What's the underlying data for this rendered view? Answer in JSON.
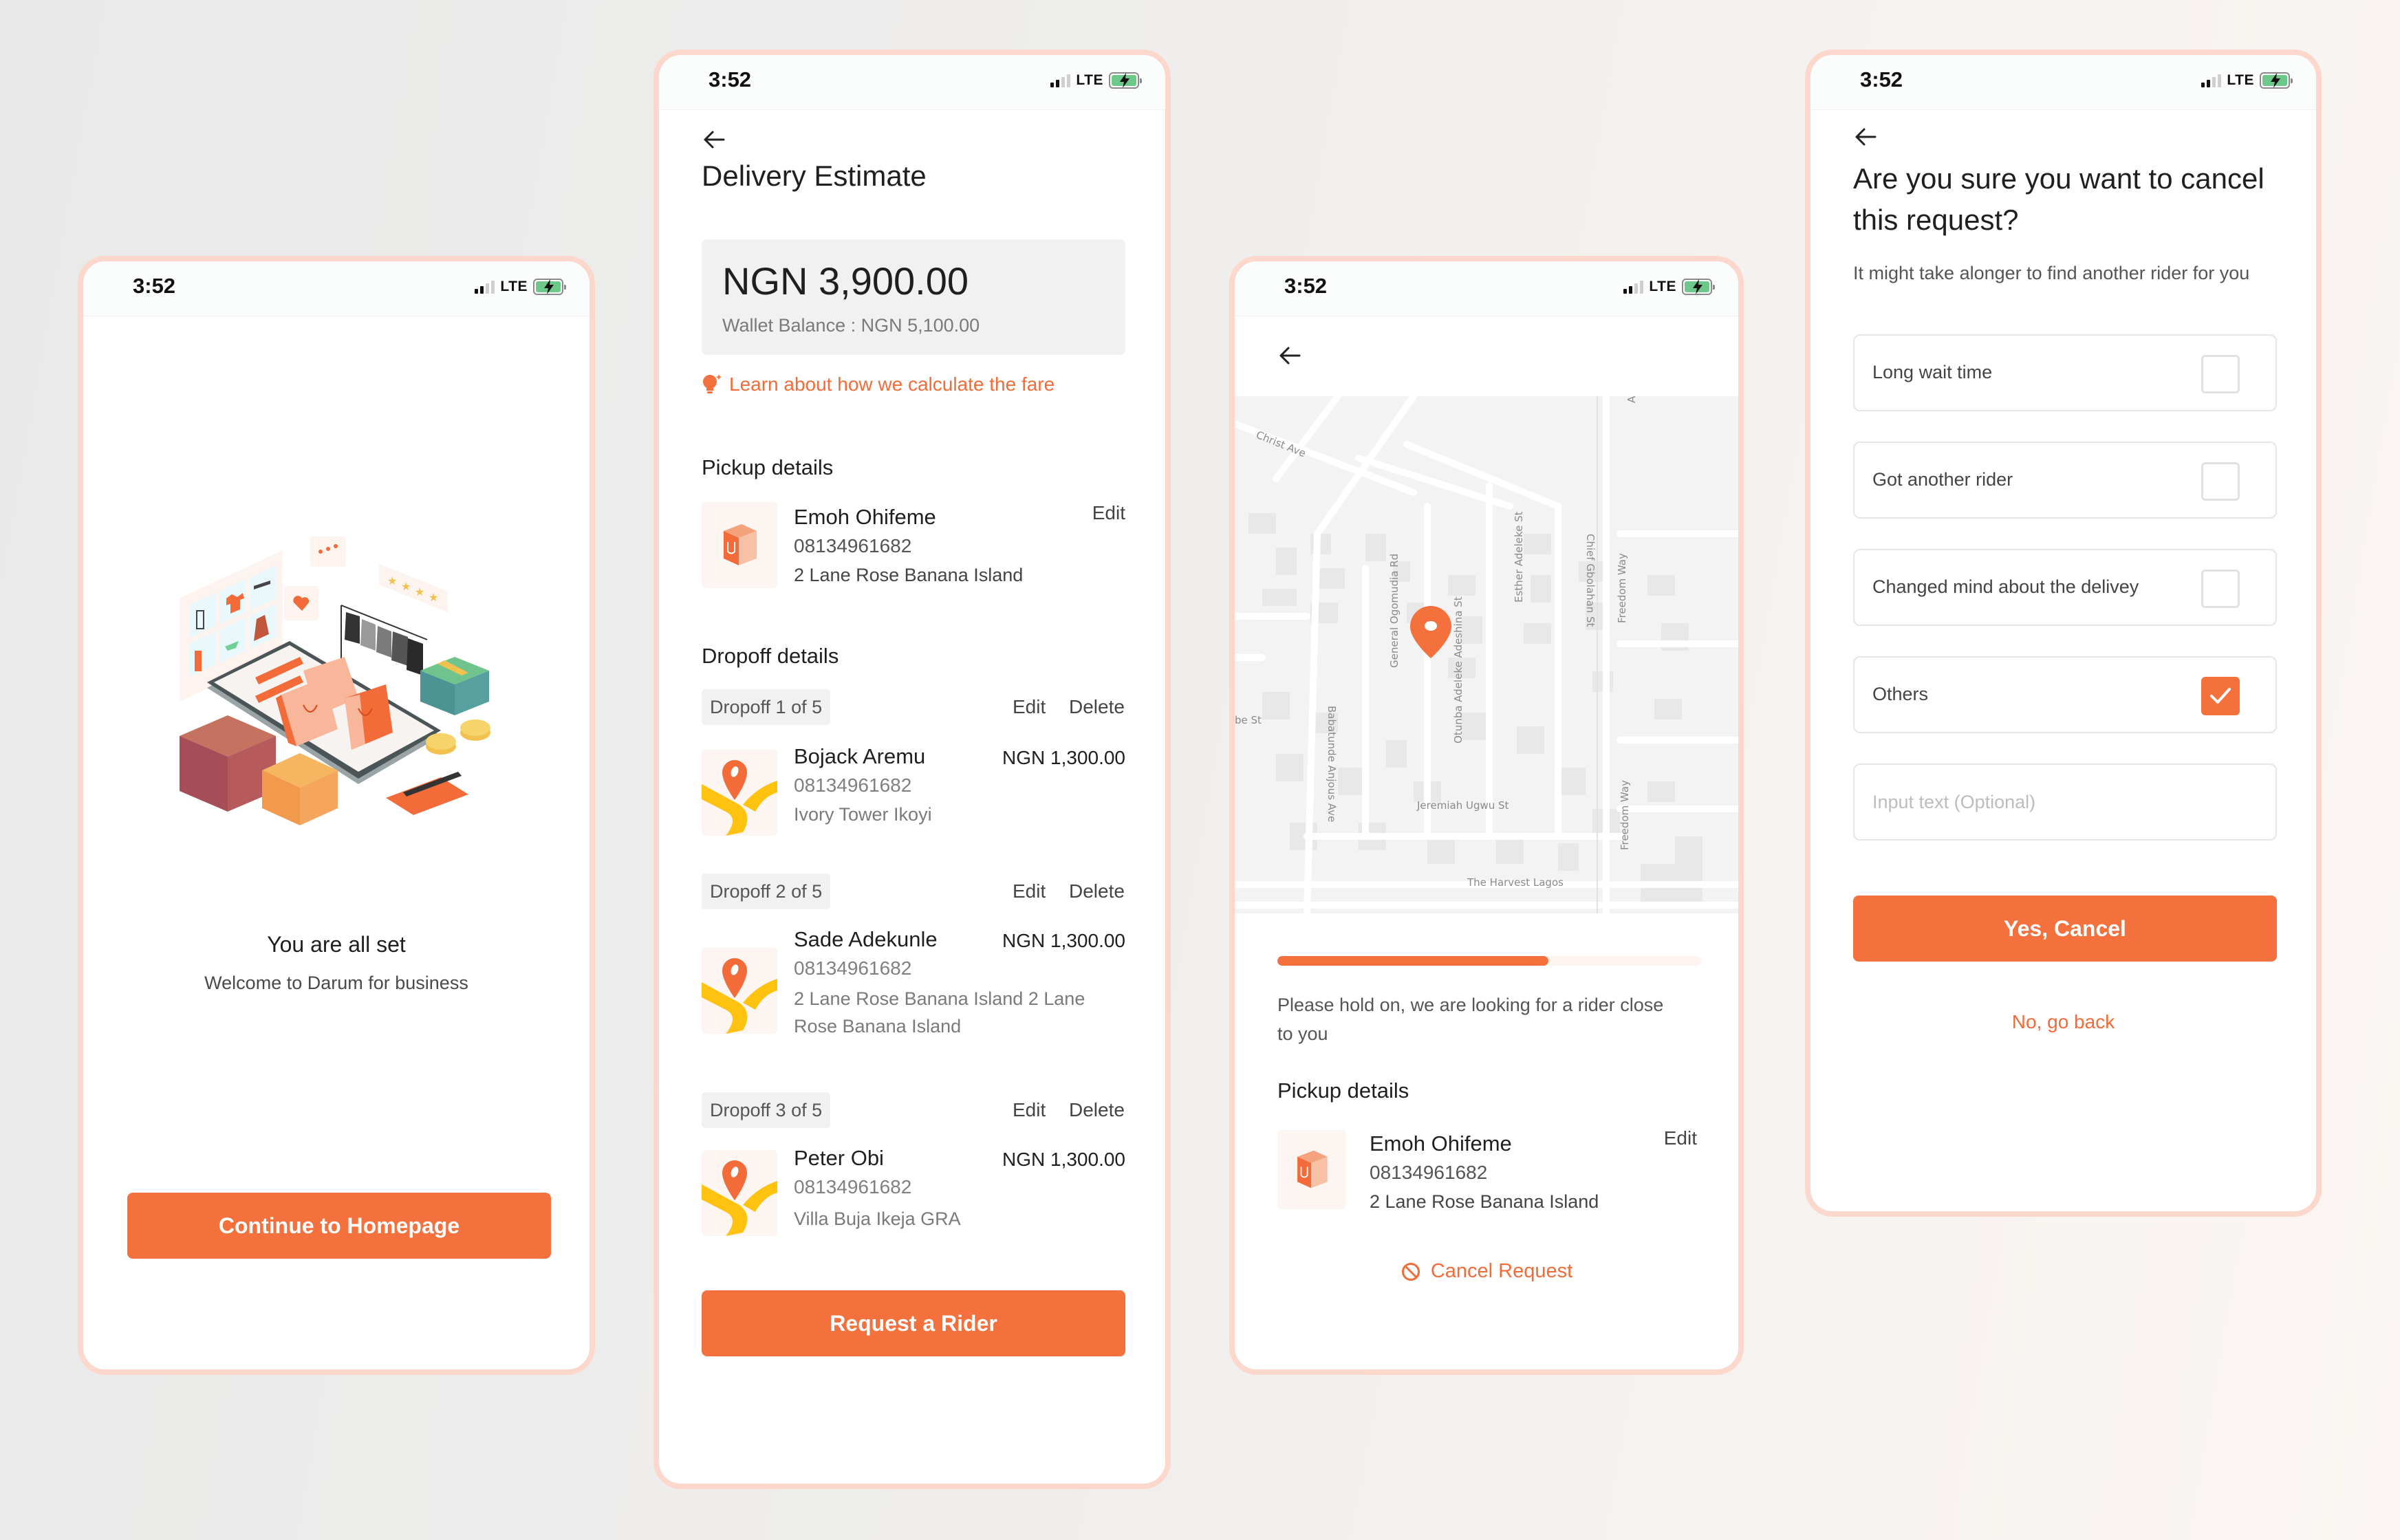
{
  "status_bar": {
    "time": "3:52",
    "network": "LTE",
    "signal_bars_active": 2,
    "signal_bars_total": 4,
    "battery_state": "charging"
  },
  "colors": {
    "accent": "#f4703d",
    "accent_text": "#f26b38",
    "frame_border": "#fcd8cc",
    "battery_green": "#6cc98a"
  },
  "screens": {
    "welcome": {
      "illustration": "online-shopping-illustration",
      "title": "You are all set",
      "subtitle": "Welcome to Darum for business",
      "primary_button": "Continue to Homepage"
    },
    "estimate": {
      "back_icon": "arrow-left-icon",
      "title": "Delivery Estimate",
      "fare_amount": "NGN 3,900.00",
      "wallet_balance": "Wallet Balance : NGN 5,100.00",
      "learn_link": "Learn about how we calculate the fare",
      "pickup": {
        "heading": "Pickup details",
        "name": "Emoh Ohifeme",
        "phone": "08134961682",
        "address": "2 Lane Rose Banana Island",
        "edit_label": "Edit"
      },
      "dropoff_heading": "Dropoff details",
      "dropoffs": [
        {
          "tag": "Dropoff 1 of 5",
          "edit_label": "Edit",
          "delete_label": "Delete",
          "name": "Bojack Aremu",
          "phone": "08134961682",
          "address": "Ivory Tower Ikoyi",
          "price": "NGN 1,300.00"
        },
        {
          "tag": "Dropoff 2 of 5",
          "edit_label": "Edit",
          "delete_label": "Delete",
          "name": "Sade Adekunle",
          "phone": "08134961682",
          "address": "2 Lane Rose Banana Island 2 Lane Rose Banana Island",
          "price": "NGN 1,300.00"
        },
        {
          "tag": "Dropoff 3 of 5",
          "edit_label": "Edit",
          "delete_label": "Delete",
          "name": "Peter Obi",
          "phone": "08134961682",
          "address": "Villa Buja Ikeja GRA",
          "price": "NGN 1,300.00"
        }
      ],
      "primary_button": "Request a Rider"
    },
    "searching": {
      "back_icon": "arrow-left-icon",
      "map": {
        "streets": [
          "Christ Ave",
          "General Ogomudia Rd",
          "Otunba Adeleke Adeshina St",
          "Esther Adeleke St",
          "Chief Gbolahan St",
          "Freedom Way",
          "Freedom Way",
          "Babatunde Anjous Ave",
          "Jeremiah Ugwu St",
          "be St",
          "A"
        ],
        "poi": "The Harvest Lagos",
        "marker": "location-pin-icon"
      },
      "progress_percent": 64,
      "message": "Please hold on, we are looking for a rider close to you",
      "pickup": {
        "heading": "Pickup details",
        "name": "Emoh Ohifeme",
        "phone": "08134961682",
        "address": "2 Lane Rose Banana Island",
        "edit_label": "Edit"
      },
      "cancel_link": "Cancel Request"
    },
    "cancel": {
      "back_icon": "arrow-left-icon",
      "question": "Are you sure you want to cancel this request?",
      "hint": "It might take alonger to find another rider for you",
      "reasons": [
        {
          "label": "Long wait time",
          "checked": false
        },
        {
          "label": "Got another rider",
          "checked": false
        },
        {
          "label": "Changed mind about the delivey",
          "checked": false
        },
        {
          "label": "Others",
          "checked": true
        }
      ],
      "input_placeholder": "Input text (Optional)",
      "input_value": "",
      "confirm_button": "Yes, Cancel",
      "back_link": "No, go back"
    }
  }
}
